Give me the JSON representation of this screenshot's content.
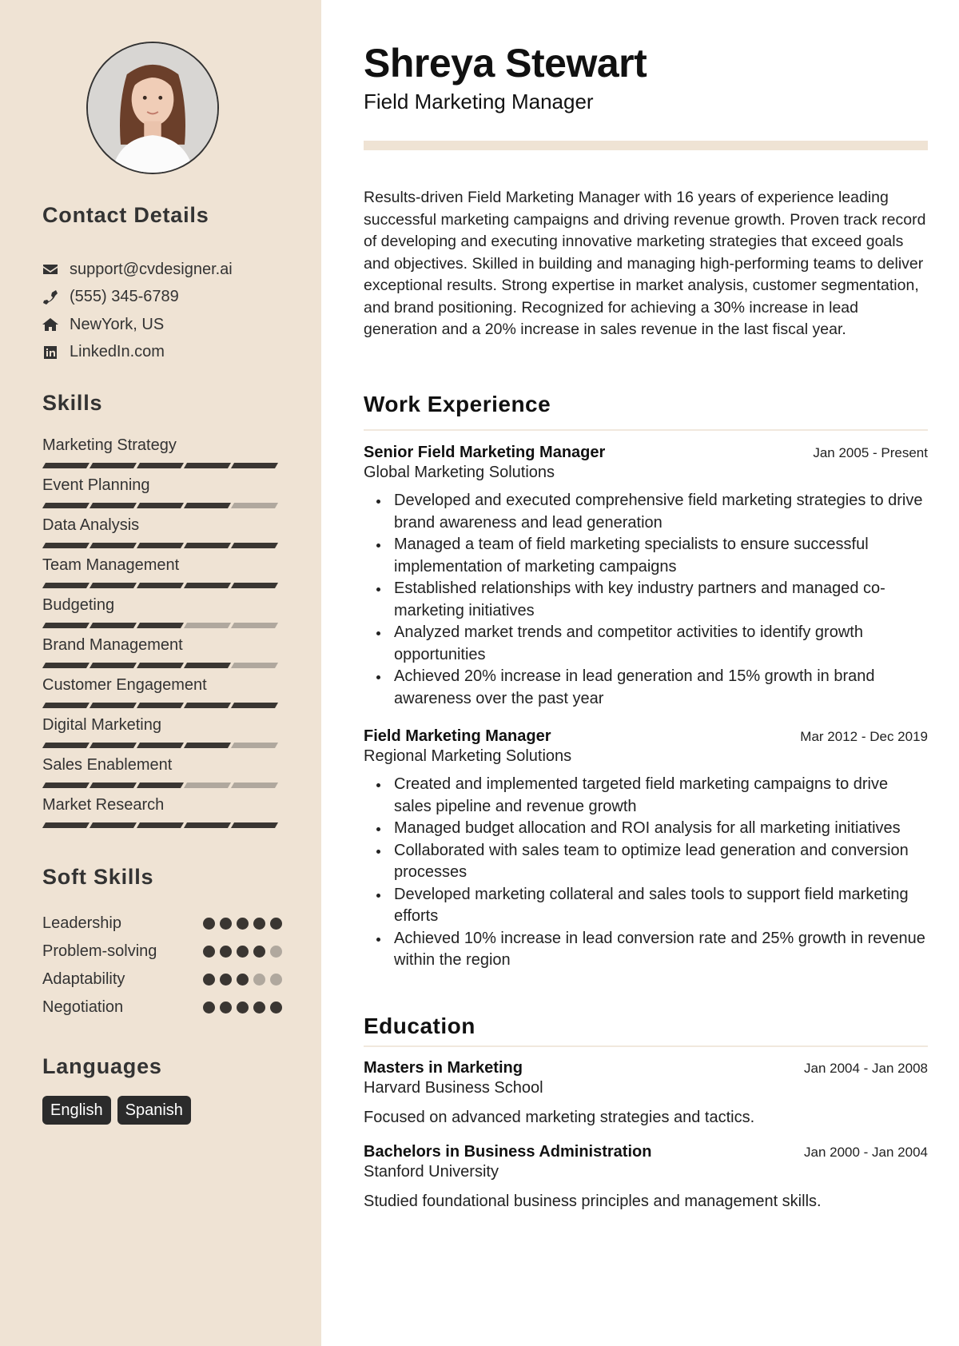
{
  "profile": {
    "name": "Shreya Stewart",
    "title": "Field Marketing Manager",
    "photo_icon": "profile-photo"
  },
  "contact": {
    "heading": "Contact Details",
    "items": [
      {
        "icon": "envelope-icon",
        "text": "support@cvdesigner.ai"
      },
      {
        "icon": "phone-icon",
        "text": "(555) 345-6789"
      },
      {
        "icon": "home-icon",
        "text": "NewYork, US"
      },
      {
        "icon": "linkedin-icon",
        "text": "LinkedIn.com"
      }
    ]
  },
  "skills": {
    "heading": "Skills",
    "max": 5,
    "items": [
      {
        "label": "Marketing Strategy",
        "level": 5
      },
      {
        "label": "Event Planning",
        "level": 4
      },
      {
        "label": "Data Analysis",
        "level": 5
      },
      {
        "label": "Team Management",
        "level": 5
      },
      {
        "label": "Budgeting",
        "level": 3
      },
      {
        "label": "Brand Management",
        "level": 4
      },
      {
        "label": "Customer Engagement",
        "level": 5
      },
      {
        "label": "Digital Marketing",
        "level": 4
      },
      {
        "label": "Sales Enablement",
        "level": 3
      },
      {
        "label": "Market Research",
        "level": 5
      }
    ]
  },
  "soft_skills": {
    "heading": "Soft Skills",
    "max": 5,
    "items": [
      {
        "label": "Leadership",
        "level": 5
      },
      {
        "label": "Problem-solving",
        "level": 4
      },
      {
        "label": "Adaptability",
        "level": 3
      },
      {
        "label": "Negotiation",
        "level": 5
      }
    ]
  },
  "languages": {
    "heading": "Languages",
    "items": [
      "English",
      "Spanish"
    ]
  },
  "summary": "Results-driven Field Marketing Manager with 16 years of experience leading successful marketing campaigns and driving revenue growth. Proven track record of developing and executing innovative marketing strategies that exceed goals and objectives. Skilled in building and managing high-performing teams to deliver exceptional results. Strong expertise in market analysis, customer segmentation, and brand positioning. Recognized for achieving a 30% increase in lead generation and a 20% increase in sales revenue in the last fiscal year.",
  "work": {
    "heading": "Work Experience",
    "jobs": [
      {
        "title": "Senior Field Marketing Manager",
        "company": "Global Marketing Solutions",
        "dates": "Jan 2005 - Present",
        "bullets": [
          "Developed and executed comprehensive field marketing strategies to drive brand awareness and lead generation",
          "Managed a team of field marketing specialists to ensure successful implementation of marketing campaigns",
          "Established relationships with key industry partners and managed co-marketing initiatives",
          "Analyzed market trends and competitor activities to identify growth opportunities",
          "Achieved 20% increase in lead generation and 15% growth in brand awareness over the past year"
        ]
      },
      {
        "title": "Field Marketing Manager",
        "company": "Regional Marketing Solutions",
        "dates": "Mar 2012 - Dec 2019",
        "bullets": [
          "Created and implemented targeted field marketing campaigns to drive sales pipeline and revenue growth",
          "Managed budget allocation and ROI analysis for all marketing initiatives",
          "Collaborated with sales team to optimize lead generation and conversion processes",
          "Developed marketing collateral and sales tools to support field marketing efforts",
          "Achieved 10% increase in lead conversion rate and 25% growth in revenue within the region"
        ]
      }
    ]
  },
  "education": {
    "heading": "Education",
    "items": [
      {
        "degree": "Masters in Marketing",
        "school": "Harvard Business School",
        "dates": "Jan 2004 - Jan 2008",
        "description": "Focused on advanced marketing strategies and tactics."
      },
      {
        "degree": "Bachelors in Business Administration",
        "school": "Stanford University",
        "dates": "Jan 2000 - Jan 2004",
        "description": "Studied foundational business principles and management skills."
      }
    ]
  },
  "colors": {
    "sidebar_bg": "#efe3d4",
    "rating_on": "#3a3632",
    "rating_off": "#b0a89e",
    "pill_bg": "#2b2b2b"
  }
}
